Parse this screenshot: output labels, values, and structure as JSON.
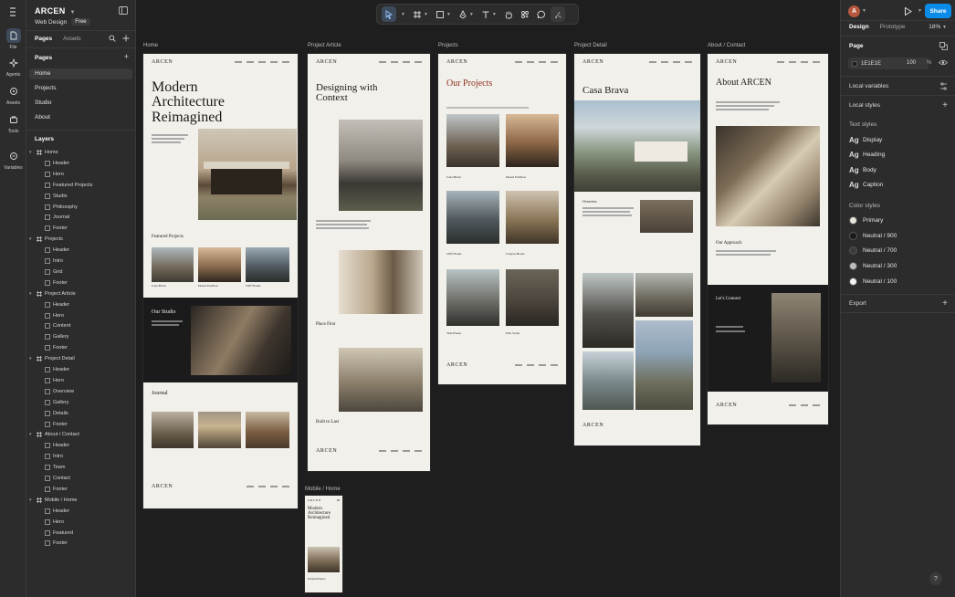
{
  "rail": {
    "items": [
      {
        "label": "File",
        "icon": "file-icon"
      },
      {
        "label": "Agents",
        "icon": "agents-icon"
      },
      {
        "label": "Assets",
        "icon": "assets-icon"
      },
      {
        "label": "Tools",
        "icon": "tools-icon"
      },
      {
        "label": "Variables",
        "icon": "variables-icon"
      }
    ]
  },
  "left": {
    "app_name": "ARCEN",
    "file_name": "Web Design",
    "plan_badge": "Free",
    "tabs": [
      "Pages",
      "Assets"
    ],
    "pages_title": "Pages",
    "pages": [
      "Home",
      "Projects",
      "Studio",
      "About"
    ],
    "layers_title": "Layers",
    "layers": [
      {
        "name": "Home",
        "children": [
          "Header",
          "Hero",
          "Featured Projects",
          "Studio",
          "Philosophy",
          "Journal",
          "Footer"
        ]
      },
      {
        "name": "Projects",
        "children": [
          "Header",
          "Intro",
          "Grid",
          "Footer"
        ]
      },
      {
        "name": "Project Article",
        "children": [
          "Header",
          "Hero",
          "Content",
          "Gallery",
          "Footer"
        ]
      },
      {
        "name": "Project Detail",
        "children": [
          "Header",
          "Hero",
          "Overview",
          "Gallery",
          "Details",
          "Footer"
        ]
      },
      {
        "name": "About / Contact",
        "children": [
          "Header",
          "Intro",
          "Team",
          "Contact",
          "Footer"
        ]
      },
      {
        "name": "Mobile / Home",
        "children": [
          "Header",
          "Hero",
          "Featured",
          "Footer"
        ]
      }
    ]
  },
  "canvas": {
    "frames": [
      {
        "label": "Home",
        "logo": "ARCEN",
        "title": "Modern Architecture Reimagined",
        "section_a": "Featured Projects",
        "section_b": "Our Studio",
        "section_c": "Journal",
        "cards": [
          "Casa Brava",
          "Desert Pavilion",
          "Cliff House"
        ]
      },
      {
        "label": "Project Article",
        "logo": "ARCEN",
        "title": "Designing with Context",
        "section_a": "Place First",
        "section_b": "Built to Last"
      },
      {
        "label": "Projects",
        "logo": "ARCEN",
        "title": "Our Projects",
        "cards": [
          "Casa Brava",
          "Desert Pavilion",
          "Cliff House",
          "Canyon House",
          "Tide House",
          "Palo Verde"
        ]
      },
      {
        "label": "Project Detail",
        "logo": "ARCEN",
        "title": "Casa Brava",
        "section_a": "Overview"
      },
      {
        "label": "About / Contact",
        "logo": "ARCEN",
        "title": "About ARCEN",
        "section_a": "Our Approach",
        "section_b": "Let's Connect"
      },
      {
        "label": "Mobile / Home",
        "logo": "ARCEN",
        "title": "Modern Architecture Reimagined",
        "section_a": "Featured Projects"
      }
    ]
  },
  "right": {
    "avatar_letter": "A",
    "share_label": "Share",
    "tabs": [
      "Design",
      "Prototype"
    ],
    "zoom": "18%",
    "page_title": "Page",
    "bg_hex": "1E1E1E",
    "bg_opacity": "100",
    "pct": "%",
    "local_variables": "Local variables",
    "local_styles": "Local styles",
    "text_styles_title": "Text styles",
    "text_styles": [
      "Display",
      "Heading",
      "Body",
      "Caption"
    ],
    "ag": "Ag",
    "color_styles_title": "Color styles",
    "color_styles": [
      {
        "name": "Primary",
        "color": "#e8e4dc"
      },
      {
        "name": "Neutral / 900",
        "color": "#1a1a1a"
      },
      {
        "name": "Neutral / 700",
        "color": "#3c3c3c"
      },
      {
        "name": "Neutral / 300",
        "color": "#bdbdbd"
      },
      {
        "name": "Neutral / 100",
        "color": "#f2f2f2"
      }
    ],
    "export": "Export",
    "help": "?"
  }
}
